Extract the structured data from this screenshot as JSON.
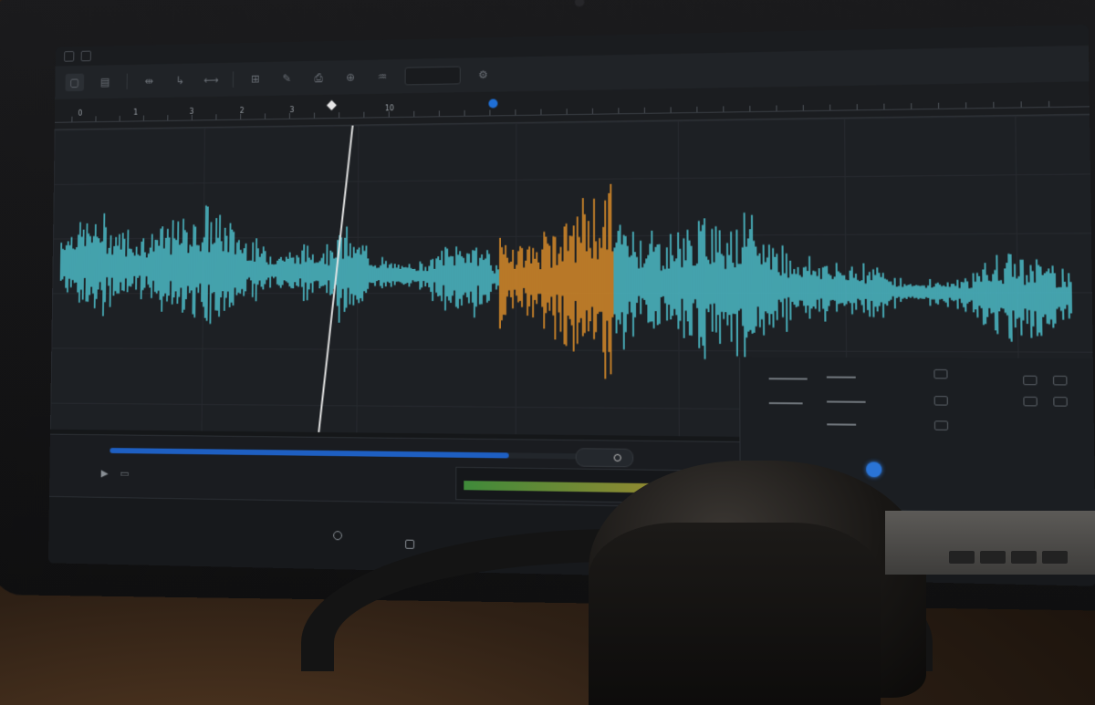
{
  "ruler": {
    "ticks": [
      {
        "label": "0",
        "x": 0
      },
      {
        "label": "1",
        "x": 1
      },
      {
        "label": "3",
        "x": 3
      },
      {
        "label": "2",
        "x": 2
      },
      {
        "label": "3",
        "x": 3
      },
      {
        "label": "10",
        "x": 10
      }
    ]
  },
  "colors": {
    "waveform_primary": "#4fc3d0",
    "waveform_selected": "#e0902a",
    "accent_blue": "#1f6fd6",
    "meter_low": "#3f8a3a",
    "meter_high": "#9a8a30"
  },
  "waveform": {
    "selection_start_fraction": 0.45,
    "selection_end_fraction": 0.56,
    "playhead_fraction": 0.29
  },
  "transport": {
    "play_icon": "play-icon",
    "loop_icon": "loop-icon",
    "progress_fraction": 0.8
  },
  "meter": {
    "level_fraction": 0.75
  },
  "mixer": {
    "pan_value_fraction": 0.45
  },
  "icons": [
    "window-icon",
    "select-tool-icon",
    "split-tool-icon",
    "zoom-icon",
    "eq-icon",
    "settings-icon"
  ]
}
